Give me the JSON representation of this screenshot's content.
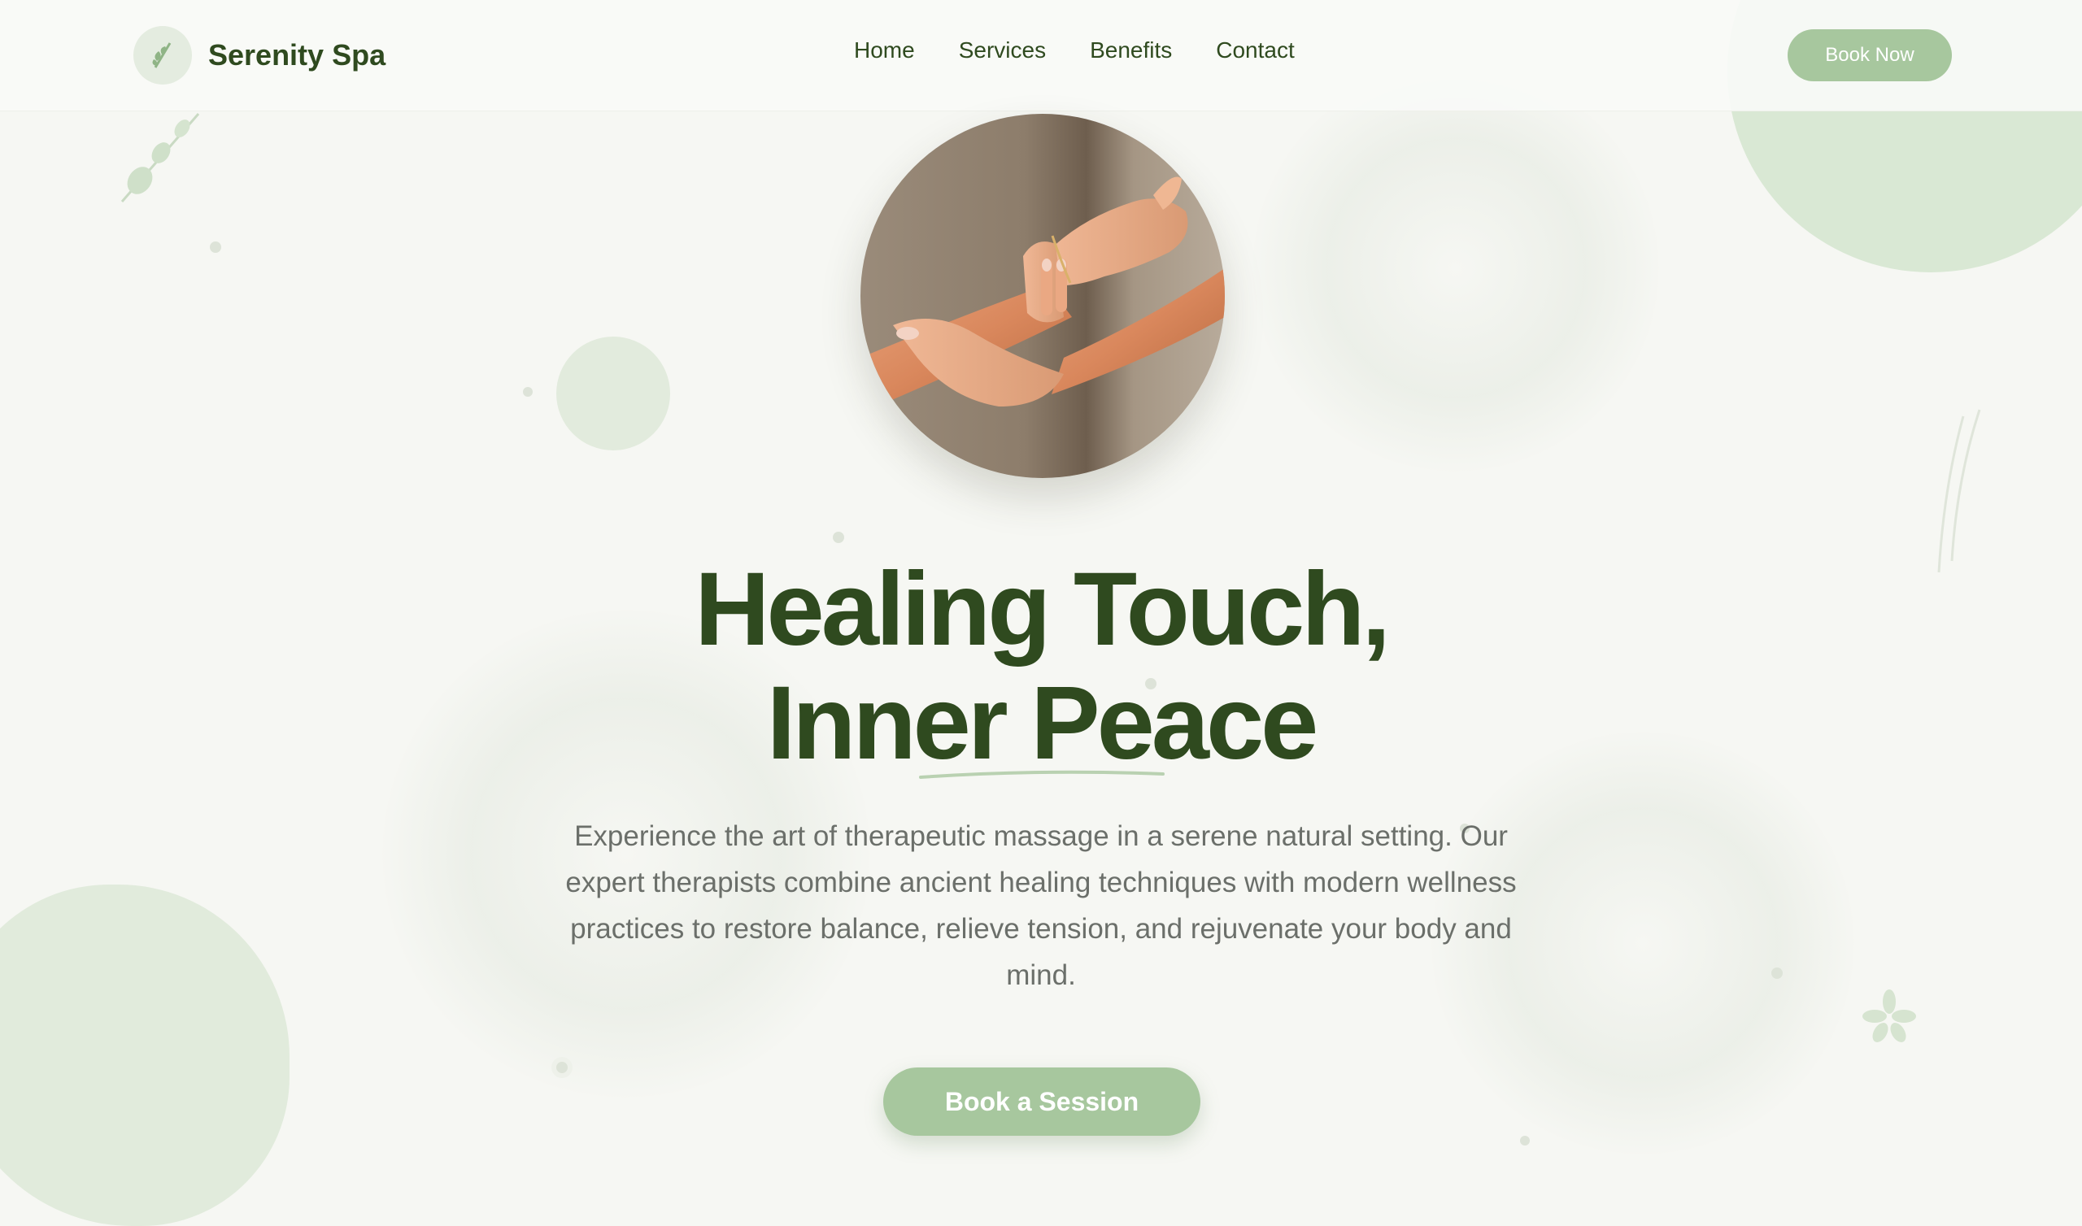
{
  "brand": {
    "name": "Serenity Spa",
    "logo_icon": "leaf-icon"
  },
  "nav": {
    "items": [
      {
        "label": "Home"
      },
      {
        "label": "Services"
      },
      {
        "label": "Benefits"
      },
      {
        "label": "Contact"
      }
    ],
    "cta_label": "Book Now"
  },
  "hero": {
    "image_alt": "hands massage photo",
    "title_line1": "Healing Touch,",
    "title_line2": "Inner Peace",
    "description": "Experience the art of therapeutic massage in a serene natural setting. Our expert therapists combine ancient healing techniques with modern wellness practices to restore balance, relieve tension, and rejuvenate your body and mind.",
    "cta_label": "Book a Session"
  },
  "colors": {
    "accent": "#a7c79e",
    "heading": "#2f4a1f",
    "body_text": "#6b6f6a",
    "background": "#f6f7f3"
  }
}
